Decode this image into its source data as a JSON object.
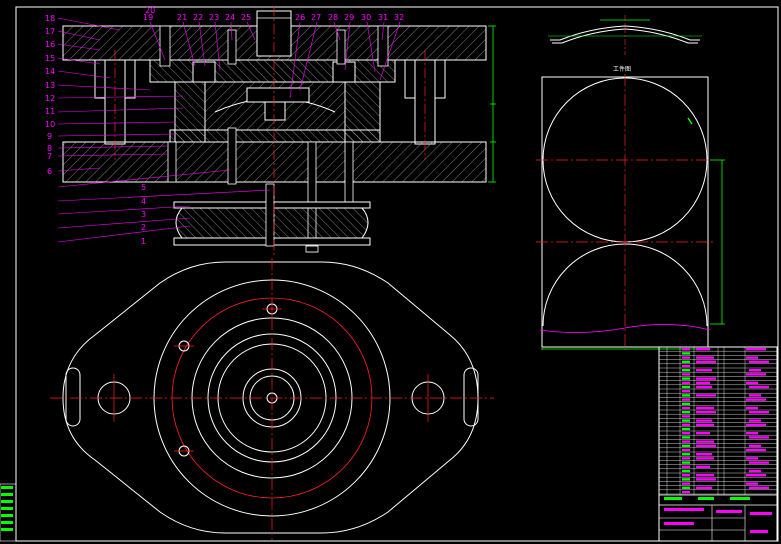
{
  "drawing": {
    "colors": {
      "background": "#000000",
      "outline": "#ffffff",
      "centerline": "#ff2020",
      "dimension": "#00ff00",
      "label": "#ff00ff",
      "hatch": "#ffffff",
      "leader": "#ff00ff"
    },
    "part_numbers": [
      "1",
      "2",
      "3",
      "4",
      "5",
      "6",
      "7",
      "8",
      "9",
      "10",
      "11",
      "12",
      "13",
      "14",
      "15",
      "16",
      "17",
      "18",
      "19",
      "20",
      "21",
      "22",
      "23",
      "24",
      "25",
      "26",
      "27",
      "28",
      "29",
      "30",
      "31",
      "32"
    ],
    "part_view_title": "工件图"
  }
}
